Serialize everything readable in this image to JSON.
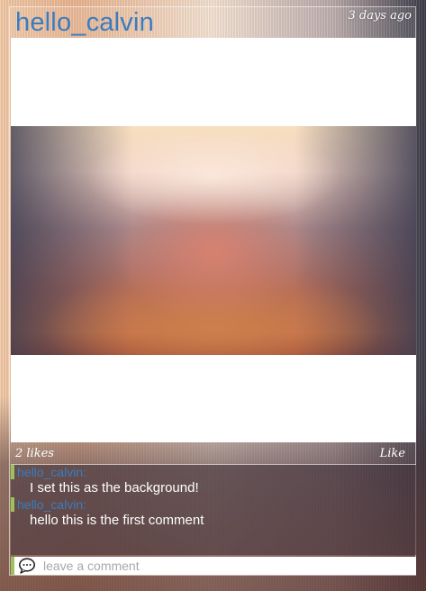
{
  "post": {
    "username": "hello_calvin",
    "timestamp": "3 days ago",
    "likes_text": "2 likes",
    "like_label": "Like"
  },
  "comments": [
    {
      "author": "hello_calvin:",
      "text": "I set this as the background!"
    },
    {
      "author": "hello_calvin:",
      "text": "hello this is the first comment"
    }
  ],
  "comment_input": {
    "placeholder": "leave a comment",
    "value": ""
  },
  "icons": {
    "comment_icon": "chat-bubble-icon"
  },
  "colors": {
    "username": "#3a7cc0",
    "accent_bar": "#9cc35a"
  }
}
